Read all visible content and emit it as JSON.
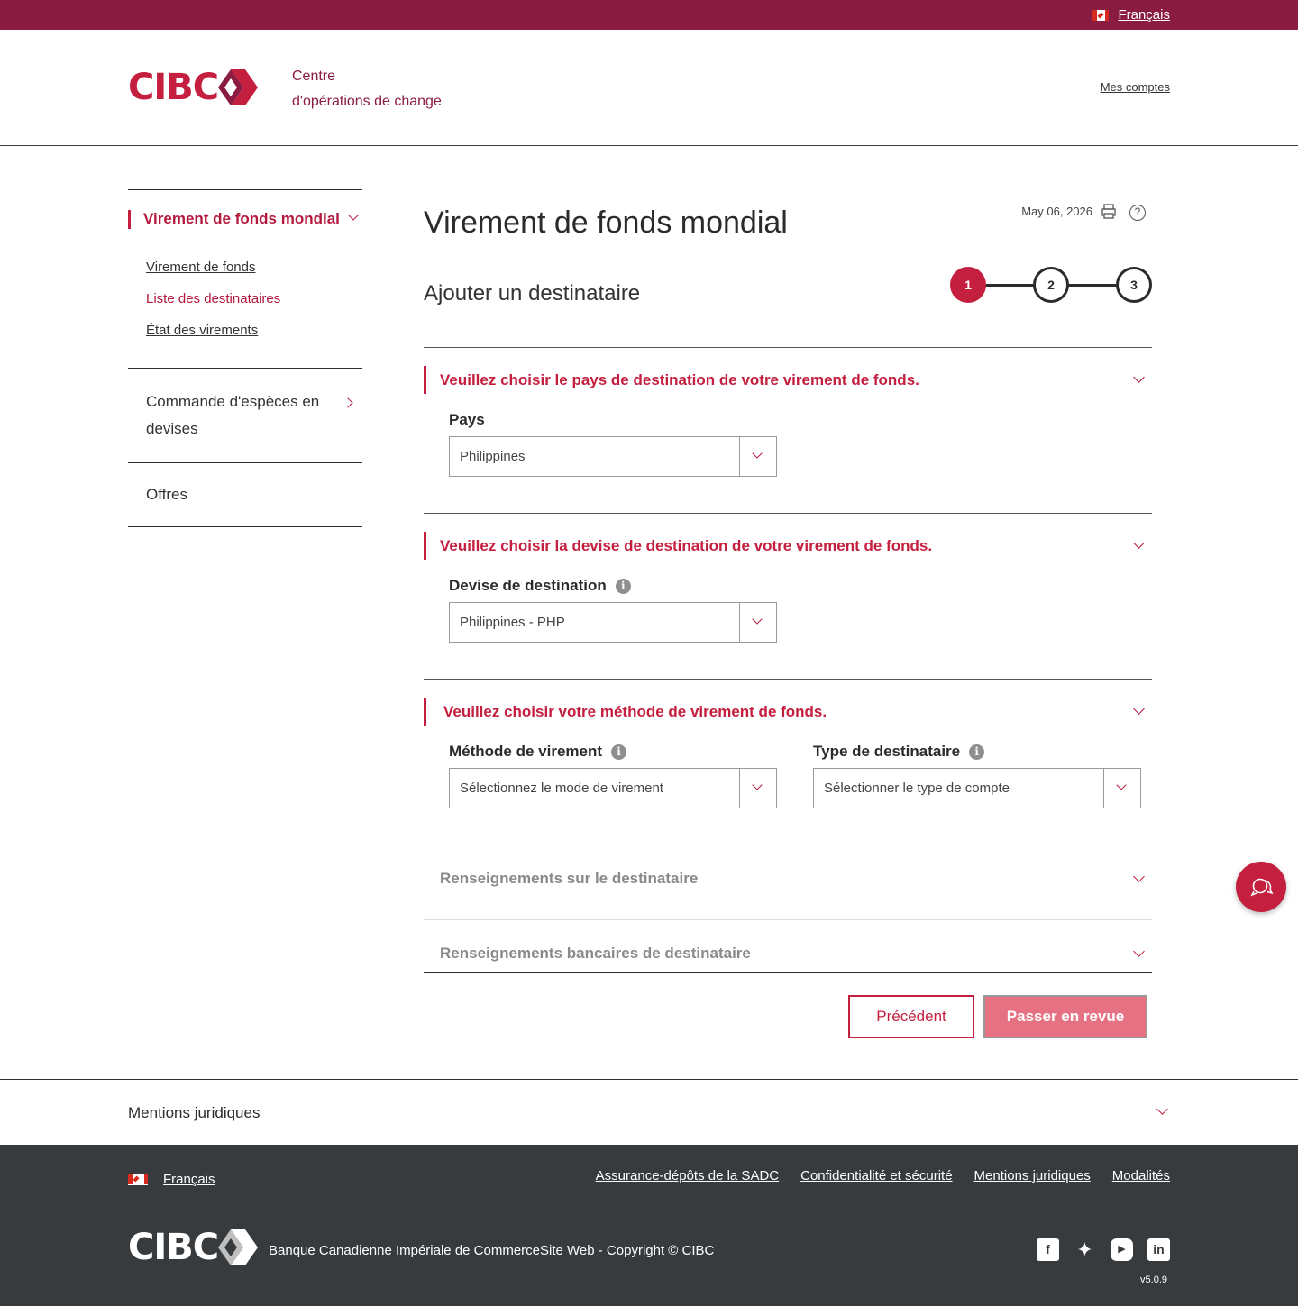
{
  "topbar": {
    "language_link": "Français"
  },
  "header": {
    "logo_text": "CIBC",
    "subtitle_line1": "Centre",
    "subtitle_line2": "d'opérations de change",
    "accounts_link": "Mes comptes"
  },
  "sidebar": {
    "active_section": "Virement de fonds mondial",
    "links": [
      "Virement de fonds",
      "Liste des destinataires",
      "État des virements"
    ],
    "item_cash_order": "Commande d'espèces en devises",
    "item_offers": "Offres"
  },
  "main": {
    "title": "Virement de fonds mondial",
    "date": "May 06, 2026",
    "subtitle": "Ajouter un destinataire",
    "steps": [
      "1",
      "2",
      "3"
    ],
    "current_step": 1,
    "sections": {
      "country": {
        "title": "Veuillez choisir le pays de destination de votre virement de fonds.",
        "label": "Pays",
        "value": "Philippines"
      },
      "currency": {
        "title": "Veuillez choisir la devise de destination de votre virement de fonds.",
        "label": "Devise de destination",
        "value": "Philippines - PHP"
      },
      "method": {
        "title": "Veuillez choisir votre méthode de virement de fonds.",
        "method_label": "Méthode de virement",
        "method_placeholder": "Sélectionnez le mode de virement",
        "type_label": "Type de destinataire",
        "type_placeholder": "Sélectionner le type de compte"
      },
      "recipient_info": {
        "title": "Renseignements sur le destinataire"
      },
      "bank_info": {
        "title": "Renseignements bancaires de destinataire"
      }
    },
    "buttons": {
      "previous": "Précédent",
      "review": "Passer en revue"
    }
  },
  "legal": {
    "title": "Mentions juridiques"
  },
  "footer": {
    "language_link": "Français",
    "links": [
      "Assurance-dépôts de la SADC",
      "Confidentialité et sécurité",
      "Mentions juridiques",
      "Modalités"
    ],
    "logo_text": "CIBC",
    "copyright": "Banque Canadienne Impériale de CommerceSite Web - Copyright © CIBC",
    "social_icons": [
      "facebook-icon",
      "twitter-icon",
      "youtube-icon",
      "linkedin-icon"
    ],
    "version": "v5.0.9"
  },
  "colors": {
    "brand_red": "#c41f3e",
    "topbar": "#8b1c41",
    "footer": "#383b3e",
    "disabled_button": "#e57183"
  }
}
